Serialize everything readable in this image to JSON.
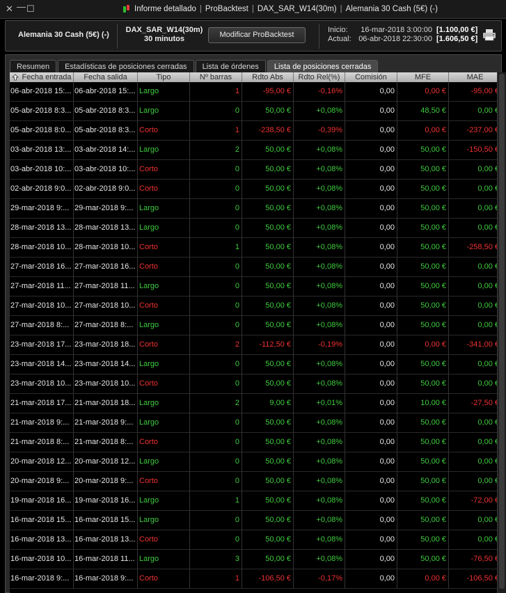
{
  "window": {
    "close_glyph": "✕",
    "minimize_glyph": "—",
    "maximize_glyph": "☐",
    "title_parts": [
      "Informe detallado",
      "ProBacktest",
      "DAX_SAR_W14(30m)",
      "Alemania 30 Cash (5€) (-)"
    ]
  },
  "header": {
    "instrument": "Alemania 30 Cash (5€) (-)",
    "strategy_name": "DAX_SAR_W14(30m)",
    "timeframe": "30 minutos",
    "modify_button": "Modificar ProBacktest",
    "start_label": "Inicio:",
    "start_date": "16-mar-2018 3:00:00",
    "start_capital": "[1.100,00 €]",
    "current_label": "Actual:",
    "current_date": "06-abr-2018 22:30:00",
    "current_capital": "[1.606,50 €]",
    "print_icon": "printer-icon"
  },
  "tabs": [
    {
      "label": "Resumen",
      "active": false
    },
    {
      "label": "Estadísticas de posiciones cerradas",
      "active": false
    },
    {
      "label": "Lista de órdenes",
      "active": false
    },
    {
      "label": "Lista de posiciones cerradas",
      "active": true
    }
  ],
  "colors": {
    "positive": "#3fcc3f",
    "negative": "#f03232",
    "neutral": "#e8e8e8"
  },
  "table": {
    "columns": [
      "Fecha entrada",
      "Fecha salida",
      "Tipo",
      "Nº barras",
      "Rdto Abs",
      "Rdto Rel(%)",
      "Comisión",
      "MFE",
      "MAE"
    ],
    "sort_column": 0,
    "rows": [
      [
        "06-abr-2018 15:...",
        "06-abr-2018 15:...",
        "Largo",
        "1",
        "-95,00 €",
        "-0,16%",
        "0,00",
        "0,00 €",
        "-95,00 €"
      ],
      [
        "05-abr-2018 8:3...",
        "05-abr-2018 8:3...",
        "Largo",
        "0",
        "50,00 €",
        "+0,08%",
        "0,00",
        "48,50 €",
        "0,00 €"
      ],
      [
        "05-abr-2018 8:0...",
        "05-abr-2018 8:3...",
        "Corto",
        "1",
        "-238,50 €",
        "-0,39%",
        "0,00",
        "0,00 €",
        "-237,00 €"
      ],
      [
        "03-abr-2018 13:...",
        "03-abr-2018 14:...",
        "Largo",
        "2",
        "50,00 €",
        "+0,08%",
        "0,00",
        "50,00 €",
        "-150,50 €"
      ],
      [
        "03-abr-2018 10:...",
        "03-abr-2018 10:...",
        "Corto",
        "0",
        "50,00 €",
        "+0,08%",
        "0,00",
        "50,00 €",
        "0,00 €"
      ],
      [
        "02-abr-2018 9:0...",
        "02-abr-2018 9:0...",
        "Corto",
        "0",
        "50,00 €",
        "+0,08%",
        "0,00",
        "50,00 €",
        "0,00 €"
      ],
      [
        "29-mar-2018 9:...",
        "29-mar-2018 9:...",
        "Largo",
        "0",
        "50,00 €",
        "+0,08%",
        "0,00",
        "50,00 €",
        "0,00 €"
      ],
      [
        "28-mar-2018 13...",
        "28-mar-2018 13...",
        "Largo",
        "0",
        "50,00 €",
        "+0,08%",
        "0,00",
        "50,00 €",
        "0,00 €"
      ],
      [
        "28-mar-2018 10...",
        "28-mar-2018 10...",
        "Corto",
        "1",
        "50,00 €",
        "+0,08%",
        "0,00",
        "50,00 €",
        "-258,50 €"
      ],
      [
        "27-mar-2018 16...",
        "27-mar-2018 16...",
        "Corto",
        "0",
        "50,00 €",
        "+0,08%",
        "0,00",
        "50,00 €",
        "0,00 €"
      ],
      [
        "27-mar-2018 11...",
        "27-mar-2018 11...",
        "Largo",
        "0",
        "50,00 €",
        "+0,08%",
        "0,00",
        "50,00 €",
        "0,00 €"
      ],
      [
        "27-mar-2018 10...",
        "27-mar-2018 10...",
        "Corto",
        "0",
        "50,00 €",
        "+0,08%",
        "0,00",
        "50,00 €",
        "0,00 €"
      ],
      [
        "27-mar-2018 8:...",
        "27-mar-2018 8:...",
        "Largo",
        "0",
        "50,00 €",
        "+0,08%",
        "0,00",
        "50,00 €",
        "0,00 €"
      ],
      [
        "23-mar-2018 17...",
        "23-mar-2018 18...",
        "Corto",
        "2",
        "-112,50 €",
        "-0,19%",
        "0,00",
        "0,00 €",
        "-341,00 €"
      ],
      [
        "23-mar-2018 14...",
        "23-mar-2018 14...",
        "Largo",
        "0",
        "50,00 €",
        "+0,08%",
        "0,00",
        "50,00 €",
        "0,00 €"
      ],
      [
        "23-mar-2018 10...",
        "23-mar-2018 10...",
        "Corto",
        "0",
        "50,00 €",
        "+0,08%",
        "0,00",
        "50,00 €",
        "0,00 €"
      ],
      [
        "21-mar-2018 17...",
        "21-mar-2018 18...",
        "Largo",
        "2",
        "9,00 €",
        "+0,01%",
        "0,00",
        "10,00 €",
        "-27,50 €"
      ],
      [
        "21-mar-2018 9:...",
        "21-mar-2018 9:...",
        "Largo",
        "0",
        "50,00 €",
        "+0,08%",
        "0,00",
        "50,00 €",
        "0,00 €"
      ],
      [
        "21-mar-2018 8:...",
        "21-mar-2018 8:...",
        "Corto",
        "0",
        "50,00 €",
        "+0,08%",
        "0,00",
        "50,00 €",
        "0,00 €"
      ],
      [
        "20-mar-2018 12...",
        "20-mar-2018 12...",
        "Largo",
        "0",
        "50,00 €",
        "+0,08%",
        "0,00",
        "50,00 €",
        "0,00 €"
      ],
      [
        "20-mar-2018 9:...",
        "20-mar-2018 9:...",
        "Corto",
        "0",
        "50,00 €",
        "+0,08%",
        "0,00",
        "50,00 €",
        "0,00 €"
      ],
      [
        "19-mar-2018 16...",
        "19-mar-2018 16...",
        "Largo",
        "1",
        "50,00 €",
        "+0,08%",
        "0,00",
        "50,00 €",
        "-72,00 €"
      ],
      [
        "16-mar-2018 15...",
        "16-mar-2018 15...",
        "Largo",
        "0",
        "50,00 €",
        "+0,08%",
        "0,00",
        "50,00 €",
        "0,00 €"
      ],
      [
        "16-mar-2018 13...",
        "16-mar-2018 13...",
        "Corto",
        "0",
        "50,00 €",
        "+0,08%",
        "0,00",
        "50,00 €",
        "0,00 €"
      ],
      [
        "16-mar-2018 10...",
        "16-mar-2018 11...",
        "Largo",
        "3",
        "50,00 €",
        "+0,08%",
        "0,00",
        "50,00 €",
        "-76,50 €"
      ],
      [
        "16-mar-2018 9:...",
        "16-mar-2018 9:...",
        "Corto",
        "1",
        "-106,50 €",
        "-0,17%",
        "0,00",
        "0,00 €",
        "-106,50 €"
      ]
    ]
  }
}
